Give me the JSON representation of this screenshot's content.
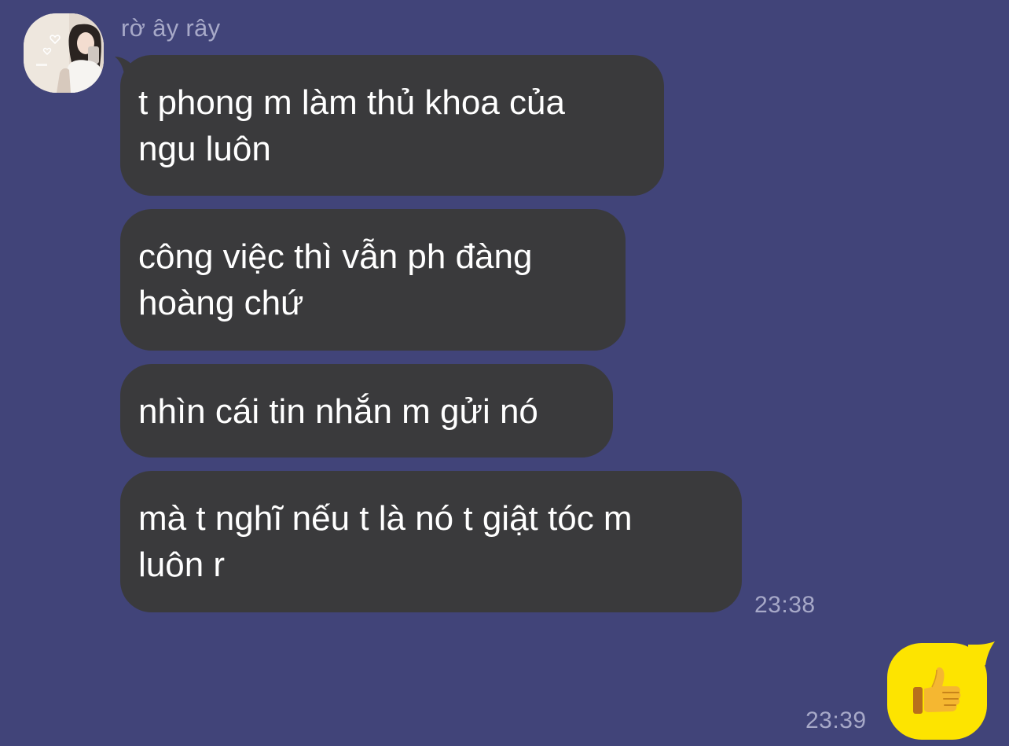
{
  "chat": {
    "sender_name": "rờ ây rây",
    "incoming_messages": [
      {
        "lines": [
          "t phong m làm thủ khoa của",
          "ngu luôn"
        ]
      },
      {
        "lines": [
          "công việc thì vẫn ph đàng",
          "hoàng chứ"
        ]
      },
      {
        "lines": [
          "nhìn cái tin nhắn m gửi nó"
        ]
      },
      {
        "lines": [
          "mà t nghĩ nếu t là nó t giật tóc m",
          "luôn r"
        ]
      }
    ],
    "incoming_time": "23:38",
    "outgoing_message": {
      "icon": "thumbs-up-icon",
      "time": "23:39"
    }
  },
  "colors": {
    "background": "#414479",
    "incoming_bubble": "#3a3a3c",
    "outgoing_bubble": "#fde400",
    "meta_text": "#a7a9c8"
  }
}
